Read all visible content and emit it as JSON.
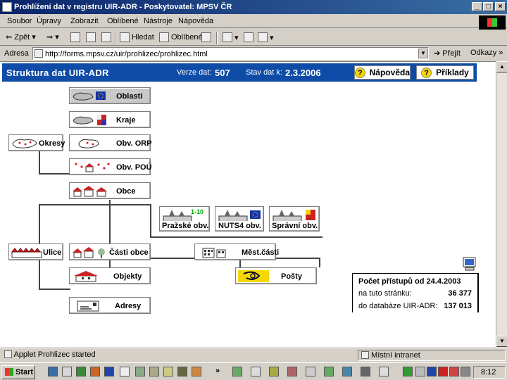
{
  "window": {
    "title": "Prohlížení dat v registru UIR-ADR - Poskytovatel: MPSV ČR",
    "buttons": {
      "minimize": "_",
      "maximize": "□",
      "close": "×"
    }
  },
  "menu": [
    "Soubor",
    "Úpravy",
    "Zobrazit",
    "Oblíbené",
    "Nástroje",
    "Nápověda"
  ],
  "toolbar": {
    "back": "Zpět",
    "search": "Hledat",
    "favorites": "Oblíbené"
  },
  "address": {
    "label": "Adresa",
    "url": "http://forms.mpsv.cz/uir/prohlizec/prohlizec.html",
    "go": "Přejít",
    "links": "Odkazy"
  },
  "header": {
    "title": "Struktura dat UIR-ADR",
    "version_label": "Verze dat:",
    "version_value": "507",
    "state_label": "Stav dat k:",
    "state_value": "2.3.2006",
    "help_button": "Nápověda",
    "examples_button": "Příklady"
  },
  "nodes": {
    "oblasti": "Oblasti",
    "kraje": "Kraje",
    "okresy": "Okresy",
    "obv_orp": "Obv. ORP",
    "obv_pou": "Obv. POÚ",
    "obce": "Obce",
    "prazske_obv": "Pražské obv.",
    "prazske_badge": "1-10",
    "nuts4_obv": "NUTS4 obv.",
    "spravni_obv": "Správní obv.",
    "ulice": "Ulice",
    "casti_obce": "Části obce",
    "mest_casti": "Měst.části",
    "objekty": "Objekty",
    "posty": "Pošty",
    "adresy": "Adresy"
  },
  "stats": {
    "title": "Počet přístupů od 24.4.2003",
    "page_label": "na tuto stránku:",
    "page_value": "36 377",
    "db_label": "do databáze UIR-ADR:",
    "db_value": "137 013"
  },
  "status": {
    "left": "Applet Prohlizec started",
    "zone": "Místní intranet"
  },
  "taskbar": {
    "start": "Start",
    "clock": "8:12",
    "overflow": "»"
  },
  "colors": {
    "header_bg": "#0f4ca7",
    "titlebar": "#0a246a",
    "help_icon": "#f5d800"
  }
}
